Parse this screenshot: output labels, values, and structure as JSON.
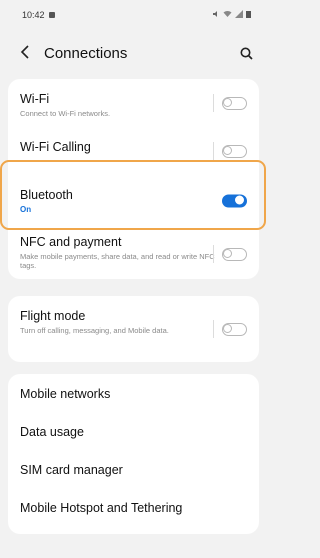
{
  "status_bar": {
    "time": "10:42"
  },
  "header": {
    "back_glyph": "<",
    "title": "Connections"
  },
  "settings_card_1": {
    "wifi": {
      "title": "Wi-Fi",
      "subtitle": "Connect to Wi-Fi networks.",
      "enabled": false
    },
    "wifi_calling": {
      "title": "Wi-Fi Calling",
      "enabled": false
    },
    "bluetooth": {
      "title": "Bluetooth",
      "subtitle": "On",
      "enabled": true
    },
    "nfc": {
      "title": "NFC and payment",
      "subtitle": "Make mobile payments, share data, and read or write NFC tags.",
      "enabled": false
    }
  },
  "settings_card_2": {
    "flight_mode": {
      "title": "Flight mode",
      "subtitle": "Turn off calling, messaging, and Mobile data.",
      "enabled": false
    }
  },
  "settings_card_3": {
    "items": [
      {
        "label": "Mobile networks"
      },
      {
        "label": "Data usage"
      },
      {
        "label": "SIM card manager"
      },
      {
        "label": "Mobile Hotspot and Tethering"
      }
    ]
  },
  "colors": {
    "accent": "#1671d9",
    "highlight": "#f0a64a"
  }
}
